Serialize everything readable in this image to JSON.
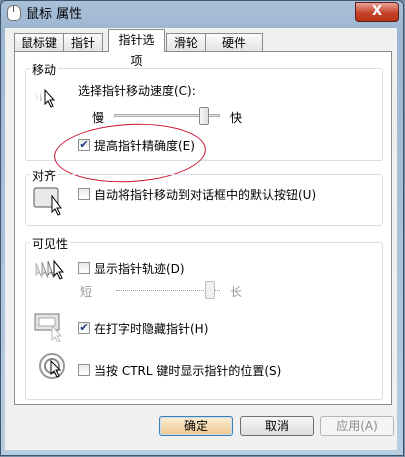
{
  "window": {
    "title": "鼠标 属性",
    "close_label": "X"
  },
  "tabs": [
    "鼠标键",
    "指针",
    "指针选项",
    "滑轮",
    "硬件"
  ],
  "active_tab": 2,
  "motion": {
    "title": "移动",
    "speed_label": "选择指针移动速度(C):",
    "slow_label": "慢",
    "fast_label": "快",
    "speed_fraction": 0.85,
    "precision_label": "提高指针精确度(E)",
    "precision_checked": true
  },
  "snap": {
    "title": "对齐",
    "label": "自动将指针移动到对话框中的默认按钮(U)",
    "checked": false
  },
  "visibility": {
    "title": "可见性",
    "trails_label": "显示指针轨迹(D)",
    "trails_checked": false,
    "short_label": "短",
    "long_label": "长",
    "trails_fraction": 0.9,
    "hide_label": "在打字时隐藏指针(H)",
    "hide_checked": true,
    "ctrl_label": "当按 CTRL 键时显示指针的位置(S)",
    "ctrl_checked": false
  },
  "buttons": {
    "ok": "确定",
    "cancel": "取消",
    "apply": "应用(A)"
  },
  "icons": {
    "app": "mouse-icon",
    "motion": "pointer-speed-icon",
    "snap": "snap-to-default-icon",
    "trails": "pointer-trails-icon",
    "hide": "hide-while-typing-icon",
    "ctrl": "ctrl-locate-icon"
  },
  "colors": {
    "annotation": "#c8102e",
    "default_button": "#f1c98e",
    "check": "#1f3c88"
  }
}
